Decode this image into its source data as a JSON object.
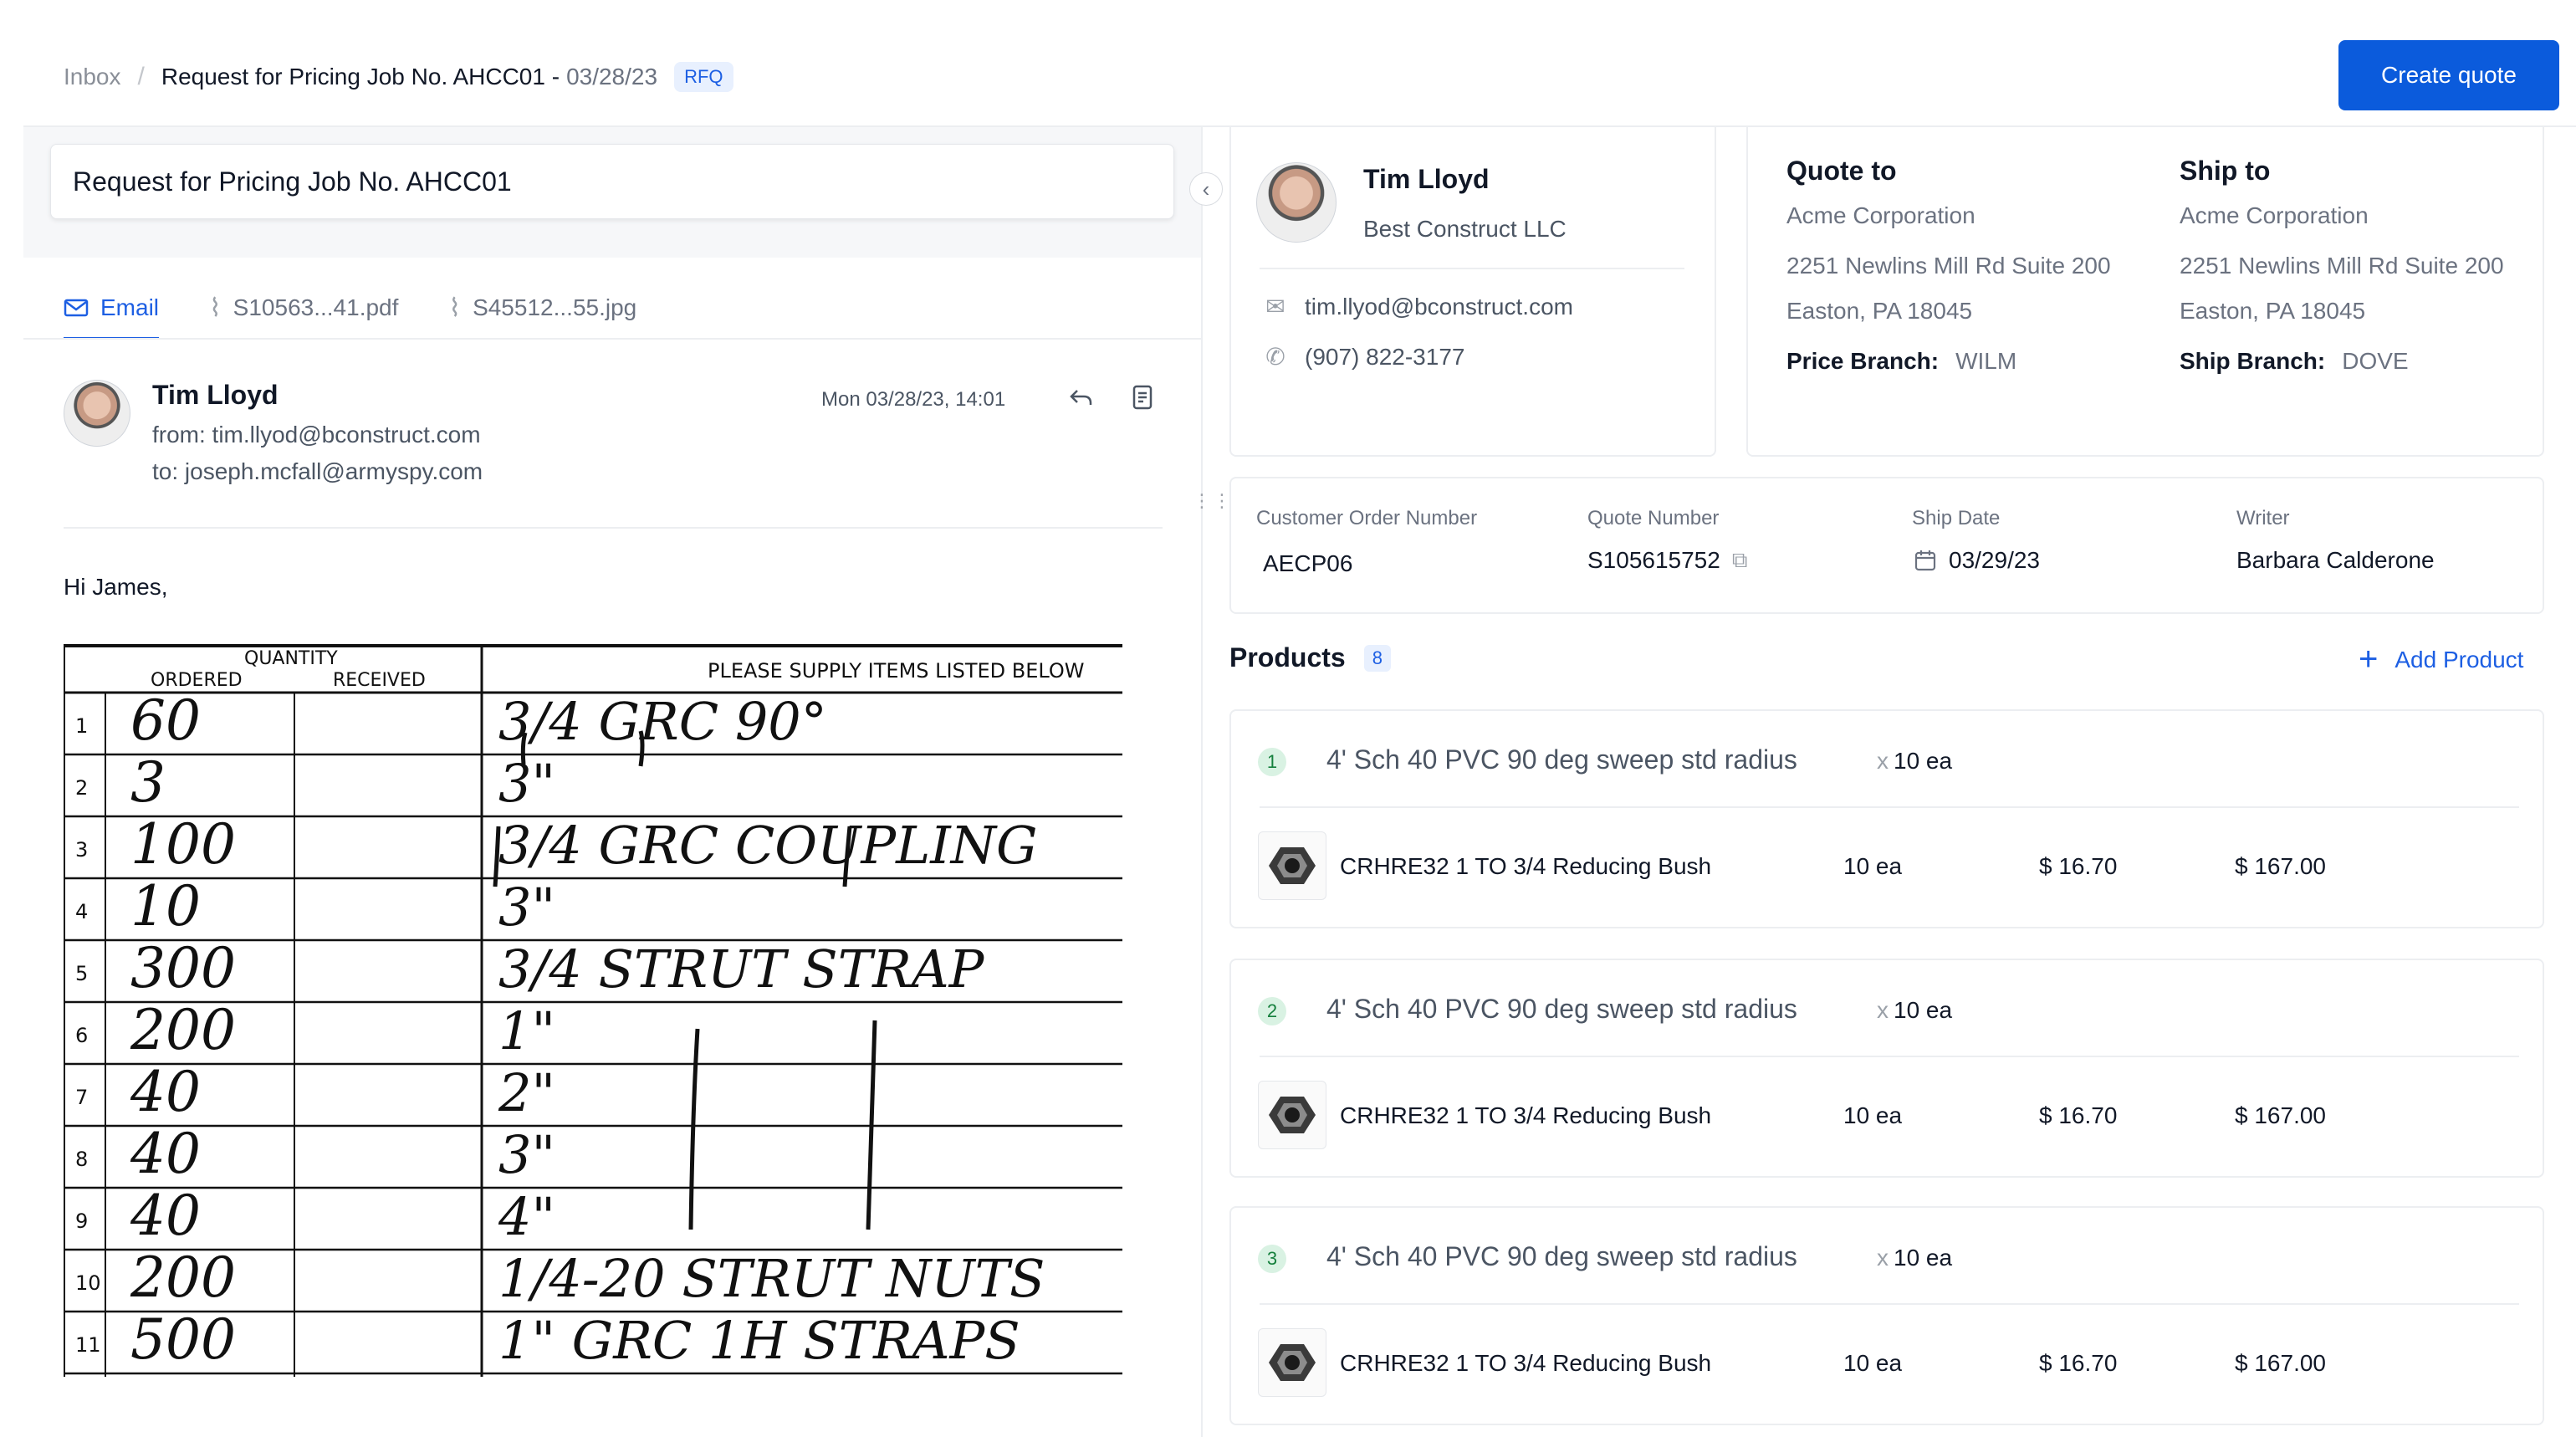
{
  "breadcrumb": {
    "inbox": "Inbox",
    "separator": "/",
    "title": "Request for Pricing Job No. AHCC01 -",
    "date": "03/28/23",
    "badge": "RFQ"
  },
  "actions": {
    "create_quote": "Create quote"
  },
  "subject": "Request for Pricing Job No. AHCC01",
  "tabs": [
    {
      "label": "Email",
      "icon": "mail-icon",
      "active": true
    },
    {
      "label": "S10563...41.pdf",
      "icon": "paperclip-icon",
      "active": false
    },
    {
      "label": "S45512...55.jpg",
      "icon": "paperclip-icon",
      "active": false
    }
  ],
  "email": {
    "sender_name": "Tim Lloyd",
    "from": "from: tim.llyod@bconstruct.com",
    "to": "to: joseph.mcfall@armyspy.com",
    "date": "Mon 03/28/23, 14:01",
    "greeting": "Hi James,"
  },
  "scan_form": {
    "header_quantity": "QUANTITY",
    "header_ordered": "ORDERED",
    "header_received": "RECEIVED",
    "header_items": "PLEASE SUPPLY ITEMS LISTED BELOW",
    "rows": [
      {
        "n": "1",
        "qty": "60",
        "item": "3/4 GRC 90°"
      },
      {
        "n": "2",
        "qty": "3",
        "item": "3\""
      },
      {
        "n": "3",
        "qty": "100",
        "item": "3/4 GRC COUPLING"
      },
      {
        "n": "4",
        "qty": "10",
        "item": "3\""
      },
      {
        "n": "5",
        "qty": "300",
        "item": "3/4 STRUT STRAP"
      },
      {
        "n": "6",
        "qty": "200",
        "item": "1\""
      },
      {
        "n": "7",
        "qty": "40",
        "item": "2\""
      },
      {
        "n": "8",
        "qty": "40",
        "item": "3\""
      },
      {
        "n": "9",
        "qty": "40",
        "item": "4\""
      },
      {
        "n": "10",
        "qty": "200",
        "item": "1/4-20 STRUT NUTS"
      },
      {
        "n": "11",
        "qty": "500",
        "item": "1\" GRC 1H STRAPS"
      }
    ]
  },
  "contact": {
    "name": "Tim Lloyd",
    "company": "Best Construct LLC",
    "email": "tim.llyod@bconstruct.com",
    "phone": "(907) 822-3177"
  },
  "quote_to": {
    "heading": "Quote to",
    "company": "Acme Corporation",
    "address1": "2251 Newlins Mill Rd Suite 200",
    "address2": "Easton, PA 18045",
    "branch_label": "Price Branch:",
    "branch_value": "WILM"
  },
  "ship_to": {
    "heading": "Ship to",
    "company": "Acme Corporation",
    "address1": "2251 Newlins Mill Rd Suite 200",
    "address2": "Easton, PA 18045",
    "branch_label": "Ship Branch:",
    "branch_value": "DOVE"
  },
  "meta": {
    "customer_order_label": "Customer Order Number",
    "customer_order_value": "AECP06",
    "quote_number_label": "Quote Number",
    "quote_number_value": "S105615752",
    "ship_date_label": "Ship Date",
    "ship_date_value": "03/29/23",
    "writer_label": "Writer",
    "writer_value": "Barbara Calderone"
  },
  "products": {
    "title": "Products",
    "count": "8",
    "add_label": "Add Product",
    "items": [
      {
        "num": "1",
        "title": "4' Sch 40 PVC 90 deg sweep std radius",
        "qty_x": "x",
        "qty": "10 ea",
        "sku_name": "CRHRE32 1 TO 3/4 Reducing Bush",
        "sku_qty": "10 ea",
        "price": "$ 16.70",
        "total": "$ 167.00"
      },
      {
        "num": "2",
        "title": "4' Sch 40 PVC 90 deg sweep std radius",
        "qty_x": "x",
        "qty": "10 ea",
        "sku_name": "CRHRE32 1 TO 3/4 Reducing Bush",
        "sku_qty": "10 ea",
        "price": "$ 16.70",
        "total": "$ 167.00"
      },
      {
        "num": "3",
        "title": "4' Sch 40 PVC 90 deg sweep std radius",
        "qty_x": "x",
        "qty": "10 ea",
        "sku_name": "CRHRE32 1 TO 3/4 Reducing Bush",
        "sku_qty": "10 ea",
        "price": "$ 16.70",
        "total": "$ 167.00"
      }
    ]
  }
}
